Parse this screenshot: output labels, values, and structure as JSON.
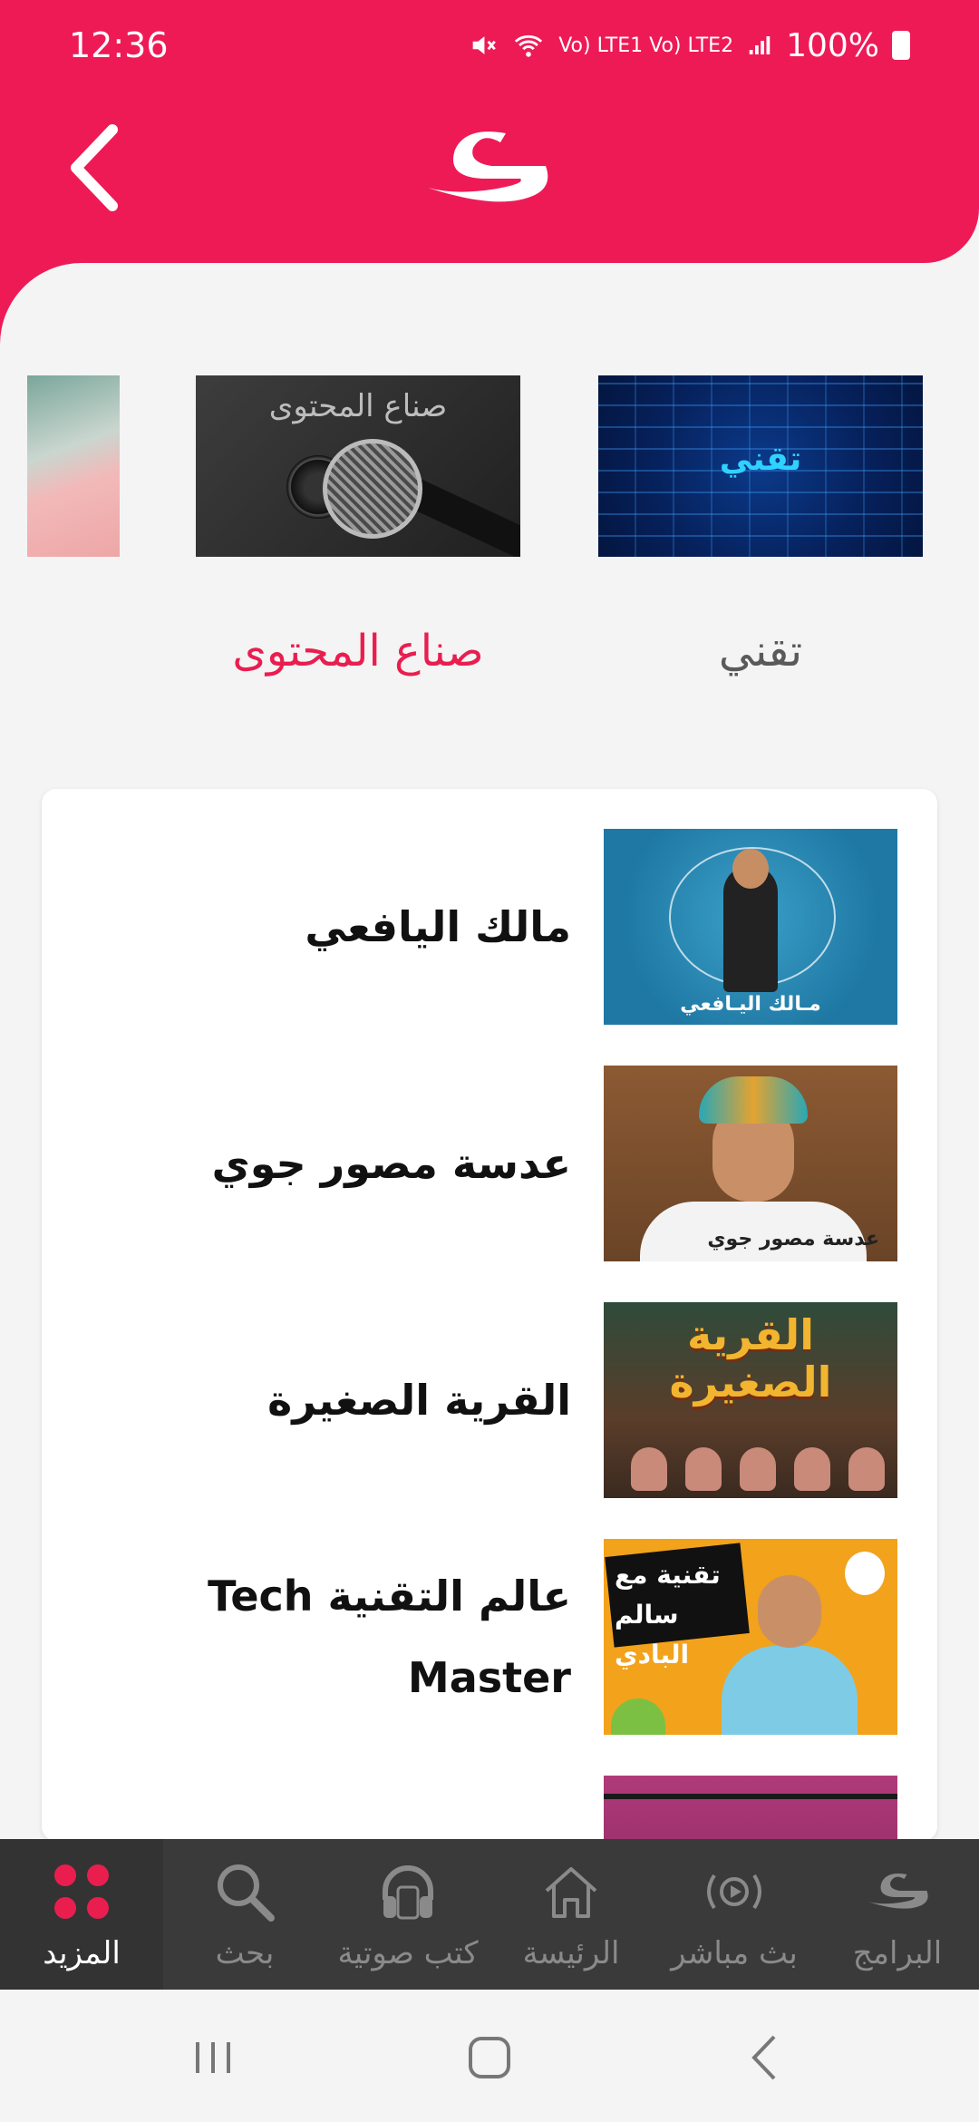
{
  "status_bar": {
    "time": "12:36",
    "network": "Vo) LTE1 Vo) LTE2",
    "battery": "100%"
  },
  "header": {
    "back_icon": "chevron-left-icon",
    "logo_icon": "brand-logo-icon",
    "accent_color": "#ee1a56"
  },
  "categories": [
    {
      "label": "تقني",
      "image_text": "تقني",
      "selected": false
    },
    {
      "label": "صناع المحتوى",
      "image_text": "صناع المحتوى",
      "selected": true
    }
  ],
  "programs": [
    {
      "title": "مالك اليافعي",
      "thumb_text": "مـالك اليـافعي"
    },
    {
      "title": "عدسة مصور جوي",
      "thumb_text": "عدسة مصور جوي"
    },
    {
      "title": "القرية الصغيرة",
      "thumb_text": "القرية الصغيرة"
    },
    {
      "title": "عالم التقنية Tech Master",
      "thumb_text": "تقنية مع سالم البادي"
    }
  ],
  "bottom_nav": [
    {
      "label": "البرامج",
      "icon": "programs-logo-icon"
    },
    {
      "label": "بث مباشر",
      "icon": "live-broadcast-icon"
    },
    {
      "label": "الرئيسة",
      "icon": "home-icon"
    },
    {
      "label": "كتب صوتية",
      "icon": "headphones-icon"
    },
    {
      "label": "بحث",
      "icon": "search-icon"
    },
    {
      "label": "المزيد",
      "icon": "more-dots-icon",
      "active": true
    }
  ],
  "colors": {
    "selected_category": "#e91e4f",
    "nav_background": "#3a3a3a"
  }
}
